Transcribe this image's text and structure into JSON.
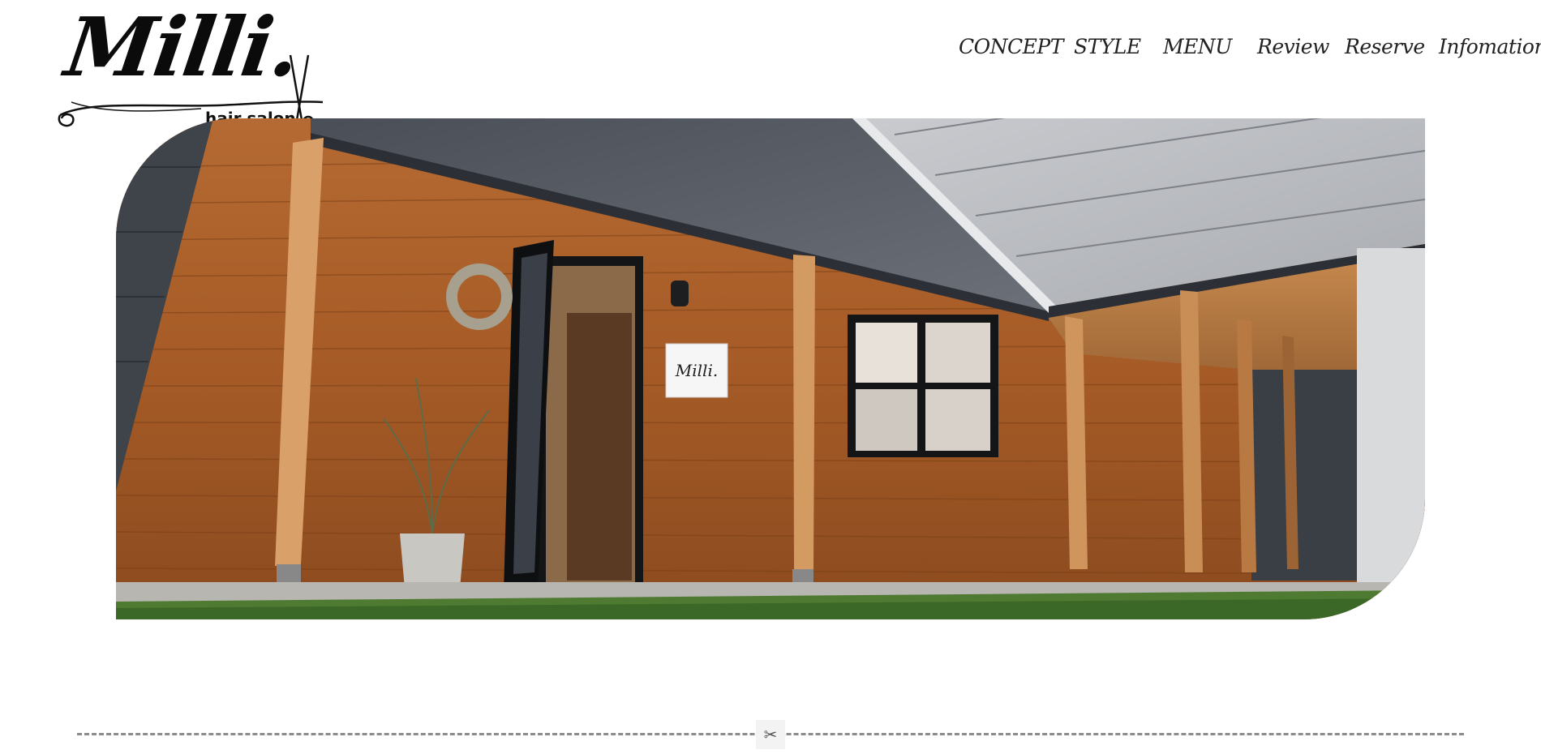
{
  "logo": {
    "wordmark": "Milli.",
    "tagline": "hair salon"
  },
  "nav": [
    {
      "label": "CONCEPT"
    },
    {
      "label": "STYLE"
    },
    {
      "label": "MENU"
    },
    {
      "label": "Review"
    },
    {
      "label": "Reserve"
    },
    {
      "label": "Infomation"
    }
  ],
  "hero": {
    "sign_text": "Milli."
  },
  "divider": {
    "icon": "scissors-icon",
    "glyph": "✂"
  }
}
